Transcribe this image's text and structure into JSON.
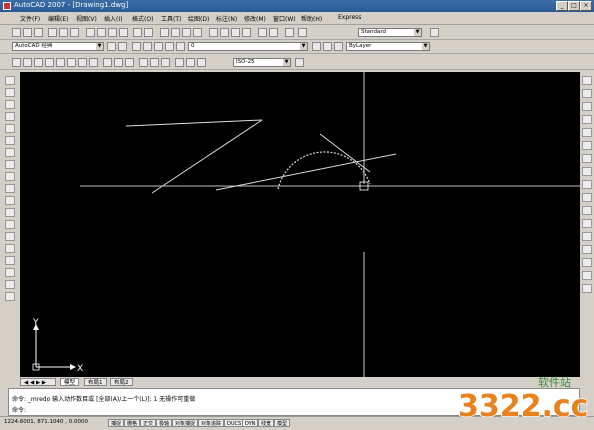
{
  "window": {
    "title": "AutoCAD 2007 - [Drawing1.dwg]"
  },
  "menu": {
    "items": [
      "文件(F)",
      "编辑(E)",
      "视图(V)",
      "插入(I)",
      "格式(O)",
      "工具(T)",
      "绘图(D)",
      "标注(N)",
      "修改(M)",
      "窗口(W)",
      "帮助(H)",
      "Express"
    ]
  },
  "toolbar2": {
    "workspace": "AutoCAD 经典",
    "layer": "0",
    "textstyle": "Standard",
    "bylayer": "ByLayer"
  },
  "toolbar3": {
    "dimstyle": "ISO-25"
  },
  "canvas": {
    "ucs_y": "Y",
    "ucs_x": "X",
    "colors": {
      "background": "#000000",
      "lines": "#ffffff"
    }
  },
  "tabs": {
    "model": "模型",
    "layout1": "布局1",
    "layout2": "布局2"
  },
  "command": {
    "line1": "命令: _mredo 输入动作数目或 [全部(A)/上一个(L)]: 1 无操作可重做",
    "line2": "命令:"
  },
  "status": {
    "coords": "1224.6001, 871.1040 , 0.0000",
    "buttons": [
      "捕捉",
      "栅格",
      "正交",
      "极轴",
      "对象捕捉",
      "对象追踪",
      "DUCS",
      "DYN",
      "线宽",
      "模型"
    ]
  },
  "watermark": {
    "brand": "3322.cc",
    "tag": "软件站"
  }
}
